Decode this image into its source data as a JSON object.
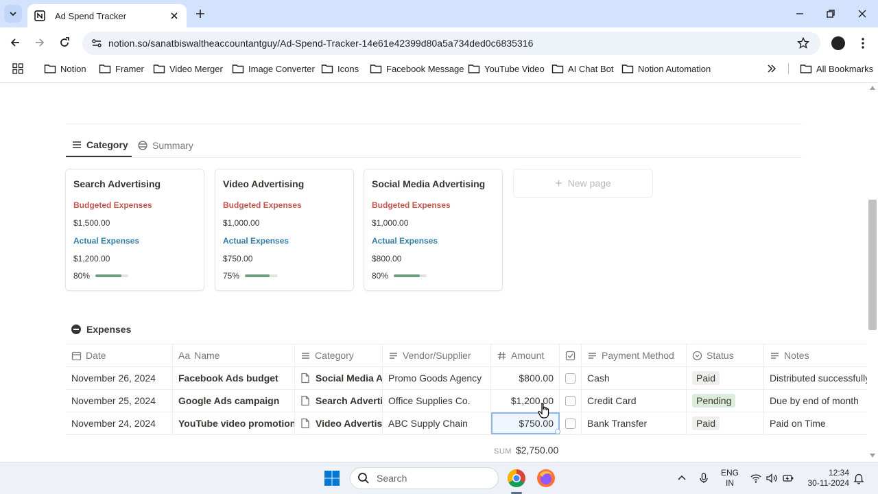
{
  "browser": {
    "tab_title": "Ad Spend Tracker",
    "url": "notion.so/sanatbiswaltheaccountantguy/Ad-Spend-Tracker-14e61e42399d80a5a734ded0c6835316",
    "bookmarks": [
      "Notion",
      "Framer",
      "Video Merger",
      "Image Converter",
      "Icons",
      "Facebook Message",
      "YouTube Video",
      "AI Chat Bot",
      "Notion Automation"
    ],
    "all_bookmarks": "All Bookmarks"
  },
  "views": {
    "active": "Category",
    "inactive": "Summary"
  },
  "cards": [
    {
      "title": "Search Advertising",
      "budget_label": "Budgeted Expenses",
      "budget": "$1,500.00",
      "actual_label": "Actual Expenses",
      "actual": "$1,200.00",
      "percent_label": "80%",
      "percent": 0.8
    },
    {
      "title": "Video Advertising",
      "budget_label": "Budgeted Expenses",
      "budget": "$1,000.00",
      "actual_label": "Actual Expenses",
      "actual": "$750.00",
      "percent_label": "75%",
      "percent": 0.75
    },
    {
      "title": "Social Media Advertising",
      "budget_label": "Budgeted Expenses",
      "budget": "$1,000.00",
      "actual_label": "Actual Expenses",
      "actual": "$800.00",
      "percent_label": "80%",
      "percent": 0.8
    }
  ],
  "new_page": "New page",
  "database": {
    "title": "Expenses",
    "columns": {
      "date": "Date",
      "name": "Name",
      "name_prefix": "Aa",
      "category": "Category",
      "vendor": "Vendor/Supplier",
      "amount": "Amount",
      "payment": "Payment Method",
      "status": "Status",
      "notes": "Notes"
    },
    "rows": [
      {
        "date": "November 26, 2024",
        "name": "Facebook Ads budget",
        "category": "Social Media Advertising",
        "vendor": "Promo Goods Agency",
        "amount": "$800.00",
        "payment": "Cash",
        "status": "Paid",
        "notes": "Distributed successfully"
      },
      {
        "date": "November 25, 2024",
        "name": "Google Ads campaign",
        "category": "Search Advertising",
        "vendor": "Office Supplies Co.",
        "amount": "$1,200.00",
        "payment": "Credit Card",
        "status": "Pending",
        "notes": "Due by end of month"
      },
      {
        "date": "November 24, 2024",
        "name": "YouTube video promotion",
        "category": "Video Advertising",
        "vendor": "ABC Supply Chain",
        "amount": "$750.00",
        "payment": "Bank Transfer",
        "status": "Paid",
        "notes": "Paid on Time"
      }
    ],
    "sum_label": "SUM",
    "sum_value": "$2,750.00"
  },
  "taskbar": {
    "search": "Search",
    "lang_top": "ENG",
    "lang_bottom": "IN",
    "time": "12:34",
    "date": "30-11-2024"
  }
}
